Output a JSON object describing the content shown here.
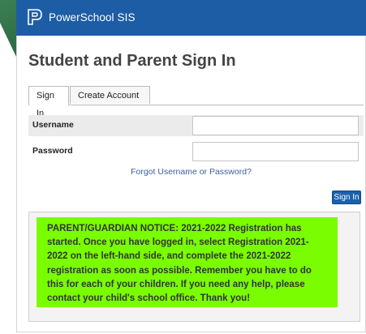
{
  "brand": {
    "logo_text": "PowerSchool SIS",
    "header_color": "#1d5da6"
  },
  "page": {
    "title": "Student and Parent Sign In"
  },
  "tabs": [
    {
      "label": "Sign In",
      "active": true
    },
    {
      "label": "Create Account",
      "active": false
    }
  ],
  "form": {
    "username_label": "Username",
    "username_value": "",
    "password_label": "Password",
    "password_value": "",
    "forgot_link": "Forgot Username or Password?",
    "submit_label": "Sign In"
  },
  "notice": {
    "text": "PARENT/GUARDIAN NOTICE: 2021-2022 Registration has started. Once you have logged in, select Registration 2021-2022 on the left-hand side, and complete the 2021-2022 registration as soon as possible. Remember you have to do this for each of your children. If you need any help, please contact your child's school office. Thank you!",
    "background_color": "#79fd00"
  }
}
